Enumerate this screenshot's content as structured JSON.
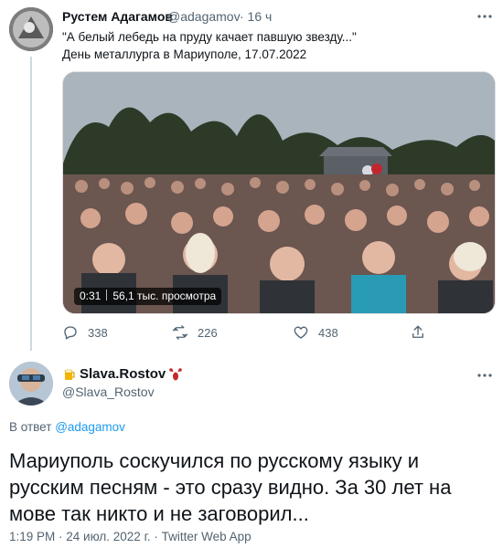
{
  "tweet": {
    "author_name": "Рустем Адагамов",
    "author_handle": "@adagamov",
    "time_ago": "· 16 ч",
    "text_line1": "\"А белый лебедь на пруду качает павшую звезду...\"",
    "text_line2": "День металлурга в Мариуполе, 17.07.2022",
    "video_duration": "0:31",
    "video_views": "56,1 тыс. просмотра",
    "reply_count": "338",
    "retweet_count": "226",
    "like_count": "438"
  },
  "reply": {
    "author_name": "Slava.Rostov",
    "author_handle": "@Slava_Rostov",
    "reply_to_prefix": "В ответ",
    "reply_to_handle": "@adagamov",
    "text": "Мариуполь соскучился по русскому языку и русским песням - это сразу видно. За 30 лет на мове так никто и не заговорил...",
    "timestamp": "1:19 PM · 24 июл. 2022 г. · Twitter Web App"
  },
  "colors": {
    "accent": "#1d9bf0",
    "muted": "#536471",
    "thread_line": "#cfd9de"
  }
}
